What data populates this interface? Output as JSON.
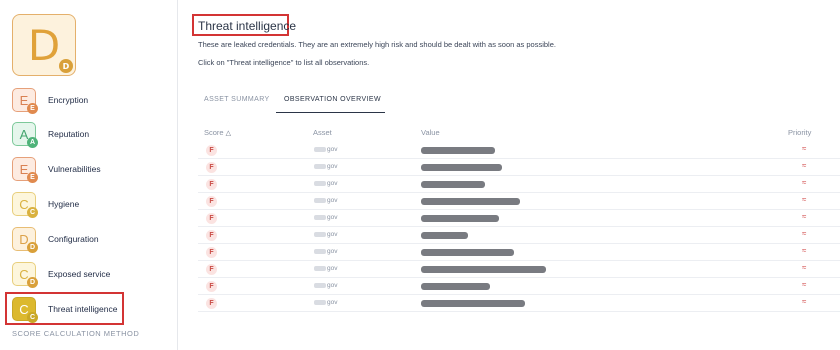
{
  "overall": {
    "grade": "D",
    "subgrade": "D",
    "color": "#e0a23a"
  },
  "categories": [
    {
      "label": "Encryption",
      "grade": "E",
      "subgrade": "E",
      "border": "#e6a07a",
      "bg": "#fdebe1",
      "text": "#d98153",
      "subbg": "#e08a4f"
    },
    {
      "label": "Reputation",
      "grade": "A",
      "subgrade": "A",
      "border": "#7dc99a",
      "bg": "#e5f6ec",
      "text": "#44a56e",
      "subbg": "#4fb37a"
    },
    {
      "label": "Vulnerabilities",
      "grade": "E",
      "subgrade": "E",
      "border": "#e6a07a",
      "bg": "#fdebe1",
      "text": "#d98153",
      "subbg": "#e08a4f"
    },
    {
      "label": "Hygiene",
      "grade": "C",
      "subgrade": "C",
      "border": "#e8cf7d",
      "bg": "#fdf6dc",
      "text": "#d9b13f",
      "subbg": "#d9b13f"
    },
    {
      "label": "Configuration",
      "grade": "D",
      "subgrade": "D",
      "border": "#e8bd74",
      "bg": "#fdf1dd",
      "text": "#dca24a",
      "subbg": "#d9a03a"
    },
    {
      "label": "Exposed service",
      "grade": "C",
      "subgrade": "D",
      "border": "#e8cf7d",
      "bg": "#fdf6dc",
      "text": "#d9b13f",
      "subbg": "#d9a03a"
    },
    {
      "label": "Threat intelligence",
      "grade": "C",
      "subgrade": "C",
      "border": "#c9a826",
      "bg": "#dcb92e",
      "text": "#ffffff",
      "subbg": "#c9a826"
    }
  ],
  "score_method": "SCORE CALCULATION METHOD",
  "main": {
    "title": "Threat intelligence",
    "description": "These are leaked credentials. They are an extremely high risk and should be dealt with as soon as possible.",
    "hint": "Click on \"Threat intelligence\" to list all observations."
  },
  "tabs": [
    {
      "label": "ASSET SUMMARY",
      "active": false
    },
    {
      "label": "OBSERVATION OVERVIEW",
      "active": true
    }
  ],
  "table": {
    "headers": {
      "score": "Score",
      "asset": "Asset",
      "value": "Value",
      "priority": "Priority"
    },
    "rows": [
      {
        "score": "F",
        "asset": "gov",
        "value_fraction": 0.58,
        "priority": "≈"
      },
      {
        "score": "F",
        "asset": "gov",
        "value_fraction": 0.63,
        "priority": "≈"
      },
      {
        "score": "F",
        "asset": "gov",
        "value_fraction": 0.5,
        "priority": "≈"
      },
      {
        "score": "F",
        "asset": "gov",
        "value_fraction": 0.77,
        "priority": "≈"
      },
      {
        "score": "F",
        "asset": "gov",
        "value_fraction": 0.61,
        "priority": "≈"
      },
      {
        "score": "F",
        "asset": "gov",
        "value_fraction": 0.37,
        "priority": "≈"
      },
      {
        "score": "F",
        "asset": "gov",
        "value_fraction": 0.73,
        "priority": "≈"
      },
      {
        "score": "F",
        "asset": "gov",
        "value_fraction": 0.98,
        "priority": "≈"
      },
      {
        "score": "F",
        "asset": "gov",
        "value_fraction": 0.54,
        "priority": "≈"
      },
      {
        "score": "F",
        "asset": "gov",
        "value_fraction": 0.81,
        "priority": "≈"
      }
    ]
  }
}
